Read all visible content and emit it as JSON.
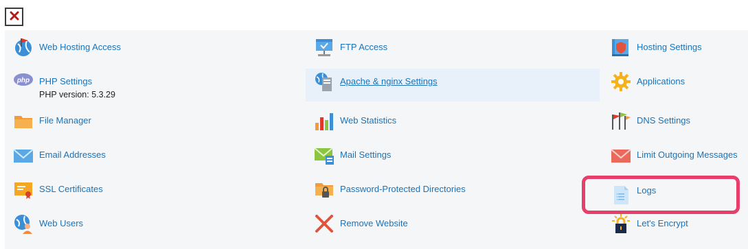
{
  "close_icon": "close-icon",
  "accent_color": "#1a73b8",
  "highlight_color": "#e83e6c",
  "columns": [
    [
      {
        "label": "Web Hosting Access",
        "icon": "web-hosting-access-icon"
      },
      {
        "label": "PHP Settings",
        "icon": "php-icon",
        "sub": "PHP version: 5.3.29"
      },
      {
        "label": "File Manager",
        "icon": "folder-icon"
      },
      {
        "label": "Email Addresses",
        "icon": "envelope-icon"
      },
      {
        "label": "SSL Certificates",
        "icon": "certificate-icon"
      },
      {
        "label": "Web Users",
        "icon": "web-users-icon"
      }
    ],
    [
      {
        "label": "FTP Access",
        "icon": "ftp-icon"
      },
      {
        "label": "Apache & nginx Settings",
        "icon": "server-icon"
      },
      {
        "label": "Web Statistics",
        "icon": "bar-chart-icon"
      },
      {
        "label": "Mail Settings",
        "icon": "mail-settings-icon"
      },
      {
        "label": "Password-Protected Directories",
        "icon": "locked-folder-icon"
      },
      {
        "label": "Remove Website",
        "icon": "remove-icon"
      }
    ],
    [
      {
        "label": "Hosting Settings",
        "icon": "hosting-settings-icon"
      },
      {
        "label": "Applications",
        "icon": "gear-icon"
      },
      {
        "label": "DNS Settings",
        "icon": "dns-flags-icon"
      },
      {
        "label": "Limit Outgoing Messages",
        "icon": "limit-mail-icon"
      },
      {
        "label": "Logs",
        "icon": "log-file-icon"
      },
      {
        "label": "Let's Encrypt",
        "icon": "lets-encrypt-lock-icon"
      }
    ]
  ]
}
